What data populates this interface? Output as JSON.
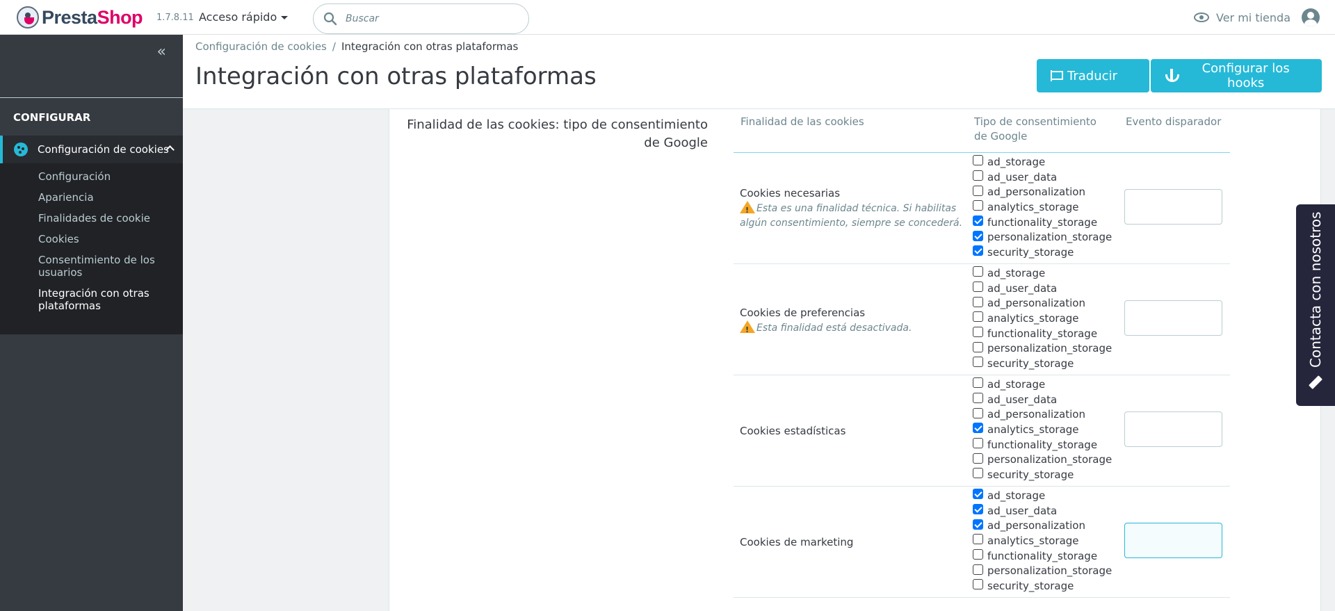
{
  "header": {
    "logo_text_a": "Presta",
    "logo_text_b": "Shop",
    "version": "1.7.8.11",
    "quick_access": "Acceso rápido",
    "search_placeholder": "Buscar",
    "view_store": "Ver mi tienda"
  },
  "sidebar": {
    "section_title": "CONFIGURAR",
    "active_item": "Configuración de cookies",
    "items": [
      {
        "label": "Configuración"
      },
      {
        "label": "Apariencia"
      },
      {
        "label": "Finalidades de cookie"
      },
      {
        "label": "Cookies"
      },
      {
        "label": "Consentimiento de los usuarios"
      },
      {
        "label": "Integración con otras plataformas"
      }
    ]
  },
  "breadcrumb": {
    "parent": "Configuración de cookies",
    "separator": "/",
    "current": "Integración con otras plataformas"
  },
  "page": {
    "title": "Integración con otras plataformas",
    "translate_button": "Traducir",
    "hooks_button": "Configurar los hooks"
  },
  "form": {
    "field_label": "Finalidad de las cookies: tipo de consentimiento de Google",
    "columns": [
      "Finalidad de las cookies",
      "Tipo de consentimiento de Google",
      "Evento disparador"
    ],
    "consent_types": [
      "ad_storage",
      "ad_user_data",
      "ad_personalization",
      "analytics_storage",
      "functionality_storage",
      "personalization_storage",
      "security_storage"
    ],
    "rows": [
      {
        "purpose": "Cookies necesarias",
        "warning": "Esta es una finalidad técnica. Si habilitas algún consentimiento, siempre se concederá.",
        "checked": [
          false,
          false,
          false,
          false,
          true,
          true,
          true
        ],
        "trigger_value": ""
      },
      {
        "purpose": "Cookies de preferencias",
        "warning": "Esta finalidad está desactivada.",
        "checked": [
          false,
          false,
          false,
          false,
          false,
          false,
          false
        ],
        "trigger_value": ""
      },
      {
        "purpose": "Cookies estadísticas",
        "warning": "",
        "checked": [
          false,
          false,
          false,
          true,
          false,
          false,
          false
        ],
        "trigger_value": ""
      },
      {
        "purpose": "Cookies de marketing",
        "warning": "",
        "checked": [
          true,
          true,
          true,
          false,
          false,
          false,
          false
        ],
        "trigger_value": ""
      }
    ]
  },
  "contact_tab": "Contacta con nosotros",
  "colors": {
    "accent": "#25b9d7",
    "sidebar": "#363a41",
    "brand_pink": "#df0067"
  }
}
